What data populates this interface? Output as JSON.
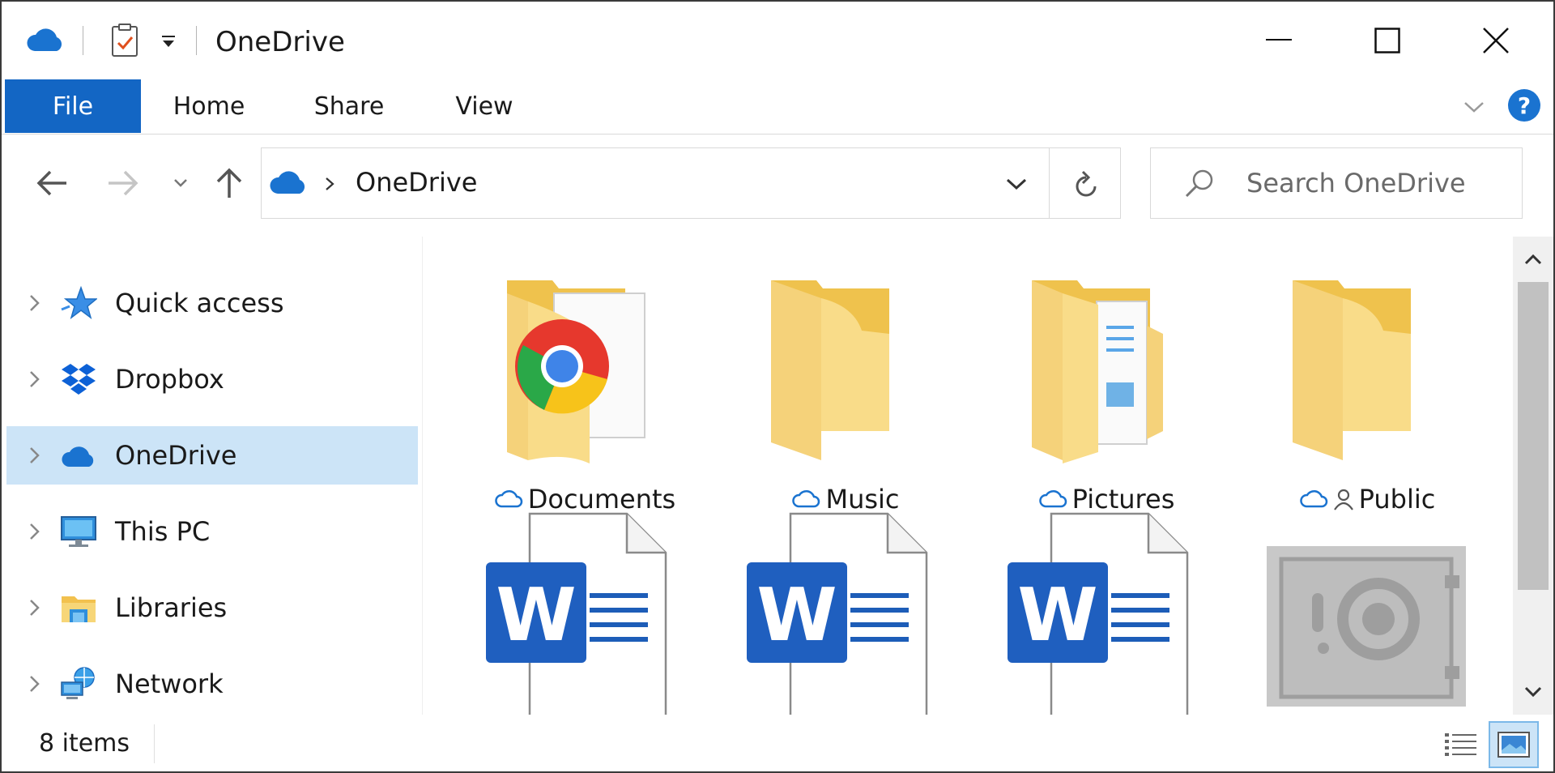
{
  "window": {
    "title": "OneDrive",
    "accent_color": "#1366c4"
  },
  "ribbon": {
    "tabs": [
      {
        "label": "File",
        "active": true
      },
      {
        "label": "Home"
      },
      {
        "label": "Share"
      },
      {
        "label": "View"
      }
    ]
  },
  "address_bar": {
    "path": "OneDrive",
    "icon": "onedrive-cloud-icon"
  },
  "search": {
    "placeholder": "Search OneDrive"
  },
  "sidebar": {
    "items": [
      {
        "label": "Quick access",
        "icon": "quick-access-star-icon"
      },
      {
        "label": "Dropbox",
        "icon": "dropbox-icon"
      },
      {
        "label": "OneDrive",
        "icon": "onedrive-cloud-icon",
        "selected": true
      },
      {
        "label": "This PC",
        "icon": "this-pc-monitor-icon"
      },
      {
        "label": "Libraries",
        "icon": "libraries-icon"
      },
      {
        "label": "Network",
        "icon": "network-icon"
      }
    ]
  },
  "content": {
    "items": [
      {
        "name": "Documents",
        "type": "folder",
        "status": "cloud"
      },
      {
        "name": "Music",
        "type": "folder",
        "status": "cloud"
      },
      {
        "name": "Pictures",
        "type": "folder",
        "status": "cloud"
      },
      {
        "name": "Public",
        "type": "folder",
        "status": "cloud-shared"
      },
      {
        "name": "",
        "type": "word-document"
      },
      {
        "name": "",
        "type": "word-document"
      },
      {
        "name": "",
        "type": "word-document"
      },
      {
        "name": "",
        "type": "personal-vault"
      }
    ]
  },
  "status_bar": {
    "item_count": "8 items"
  }
}
